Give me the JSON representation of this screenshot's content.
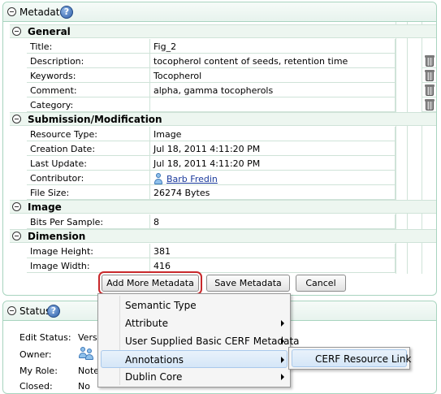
{
  "metadata_panel": {
    "title": "Metadata",
    "sections": [
      {
        "title": "General",
        "rows": [
          {
            "label": "Title:",
            "value": "Fig_2",
            "trash": false
          },
          {
            "label": "Description:",
            "value": "tocopherol content of seeds, retention time",
            "trash": true
          },
          {
            "label": "Keywords:",
            "value": "Tocopherol",
            "trash": true
          },
          {
            "label": "Comment:",
            "value": "alpha, gamma tocopherols",
            "trash": true
          },
          {
            "label": "Category:",
            "value": "",
            "trash": true
          }
        ]
      },
      {
        "title": "Submission/Modification",
        "rows": [
          {
            "label": "Resource Type:",
            "value": "Image"
          },
          {
            "label": "Creation Date:",
            "value": "Jul 18, 2011 4:11:20 PM"
          },
          {
            "label": "Last Update:",
            "value": "Jul 18, 2011 4:11:20 PM"
          },
          {
            "label": "Contributor:",
            "value": "Barb Fredin",
            "link": true
          },
          {
            "label": "File Size:",
            "value": "26274 Bytes"
          }
        ]
      },
      {
        "title": "Image",
        "rows": [
          {
            "label": "Bits Per Sample:",
            "value": "8"
          }
        ]
      },
      {
        "title": "Dimension",
        "rows": [
          {
            "label": "Image Height:",
            "value": "381"
          },
          {
            "label": "Image Width:",
            "value": "416"
          }
        ]
      }
    ],
    "buttons": {
      "add_more": "Add More Metadata",
      "save": "Save Metadata",
      "cancel": "Cancel"
    }
  },
  "context_menu": {
    "items": [
      {
        "label": "Semantic Type",
        "submenu": false
      },
      {
        "label": "Attribute",
        "submenu": true
      },
      {
        "label": "User Supplied Basic CERF Metadata",
        "submenu": true
      },
      {
        "label": "Annotations",
        "submenu": true,
        "active": true
      },
      {
        "label": "Dublin Core",
        "submenu": true
      }
    ],
    "submenu_item": "CERF Resource Link"
  },
  "status_panel": {
    "title": "Status",
    "rows": [
      {
        "label": "Edit Status:",
        "value": "Versi"
      },
      {
        "label": "Owner:",
        "value": ""
      },
      {
        "label": "My Role:",
        "value": "Notel"
      },
      {
        "label": "Closed:",
        "value": "No"
      }
    ]
  },
  "icons": {
    "help": "help-icon",
    "collapse": "collapse-icon",
    "delete": "trash-icon",
    "user": "user-icon",
    "group": "group-icon"
  }
}
